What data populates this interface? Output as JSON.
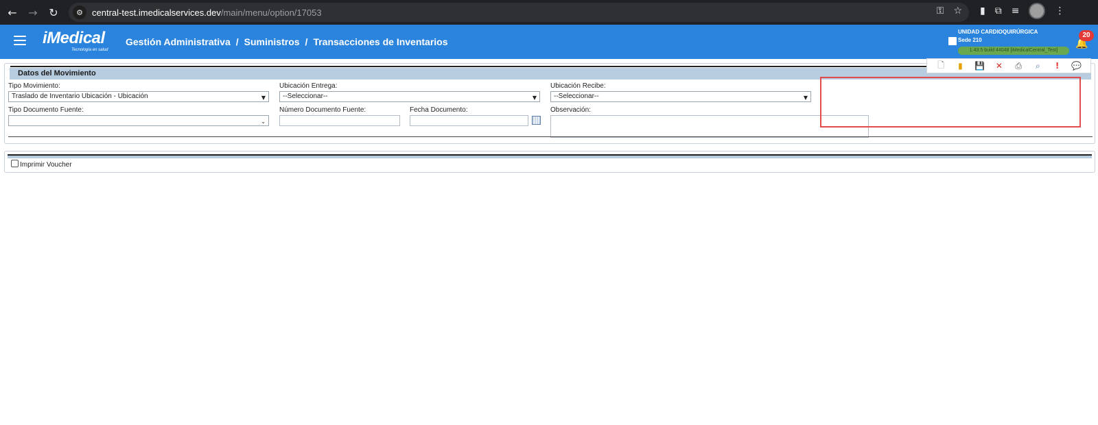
{
  "browser": {
    "url_host": "central-test.imedicalservices.dev",
    "url_path": "/main/menu/option/17053"
  },
  "header": {
    "logo_text": "iMedical",
    "logo_tagline": "Tecnología en salud",
    "breadcrumb": [
      "Gestión Administrativa",
      "/",
      "Suministros",
      "/",
      "Transacciones de Inventarios"
    ],
    "unit_name": "UNIDAD CARDIOQUIRÚRGICA",
    "sede": "Sede 210",
    "version": "1.43.5 build 44048 [iMedicalCentral_Test]",
    "notifications": "20"
  },
  "form": {
    "title": "Datos del Movimiento",
    "tipo_movimiento_label": "Tipo Movimiento:",
    "tipo_movimiento_value": "Traslado de Inventario Ubicación - Ubicación",
    "ubicacion_entrega_label": "Ubicación Entrega:",
    "ubicacion_entrega_value": "--Seleccionar--",
    "ubicacion_recibe_label": "Ubicación Recibe:",
    "ubicacion_recibe_value": "--Seleccionar--",
    "tipo_documento_label": "Tipo Documento Fuente:",
    "tipo_documento_value": "",
    "numero_documento_label": "Número Documento Fuente:",
    "fecha_documento_label": "Fecha Documento:",
    "observacion_label": "Observación:"
  },
  "voucher": {
    "label": "Imprimir Voucher",
    "checked": false
  },
  "colors": {
    "header_bg": "#2a84de",
    "panel_title_bg": "#b8cce0",
    "highlight_box": "#e24b4b"
  }
}
